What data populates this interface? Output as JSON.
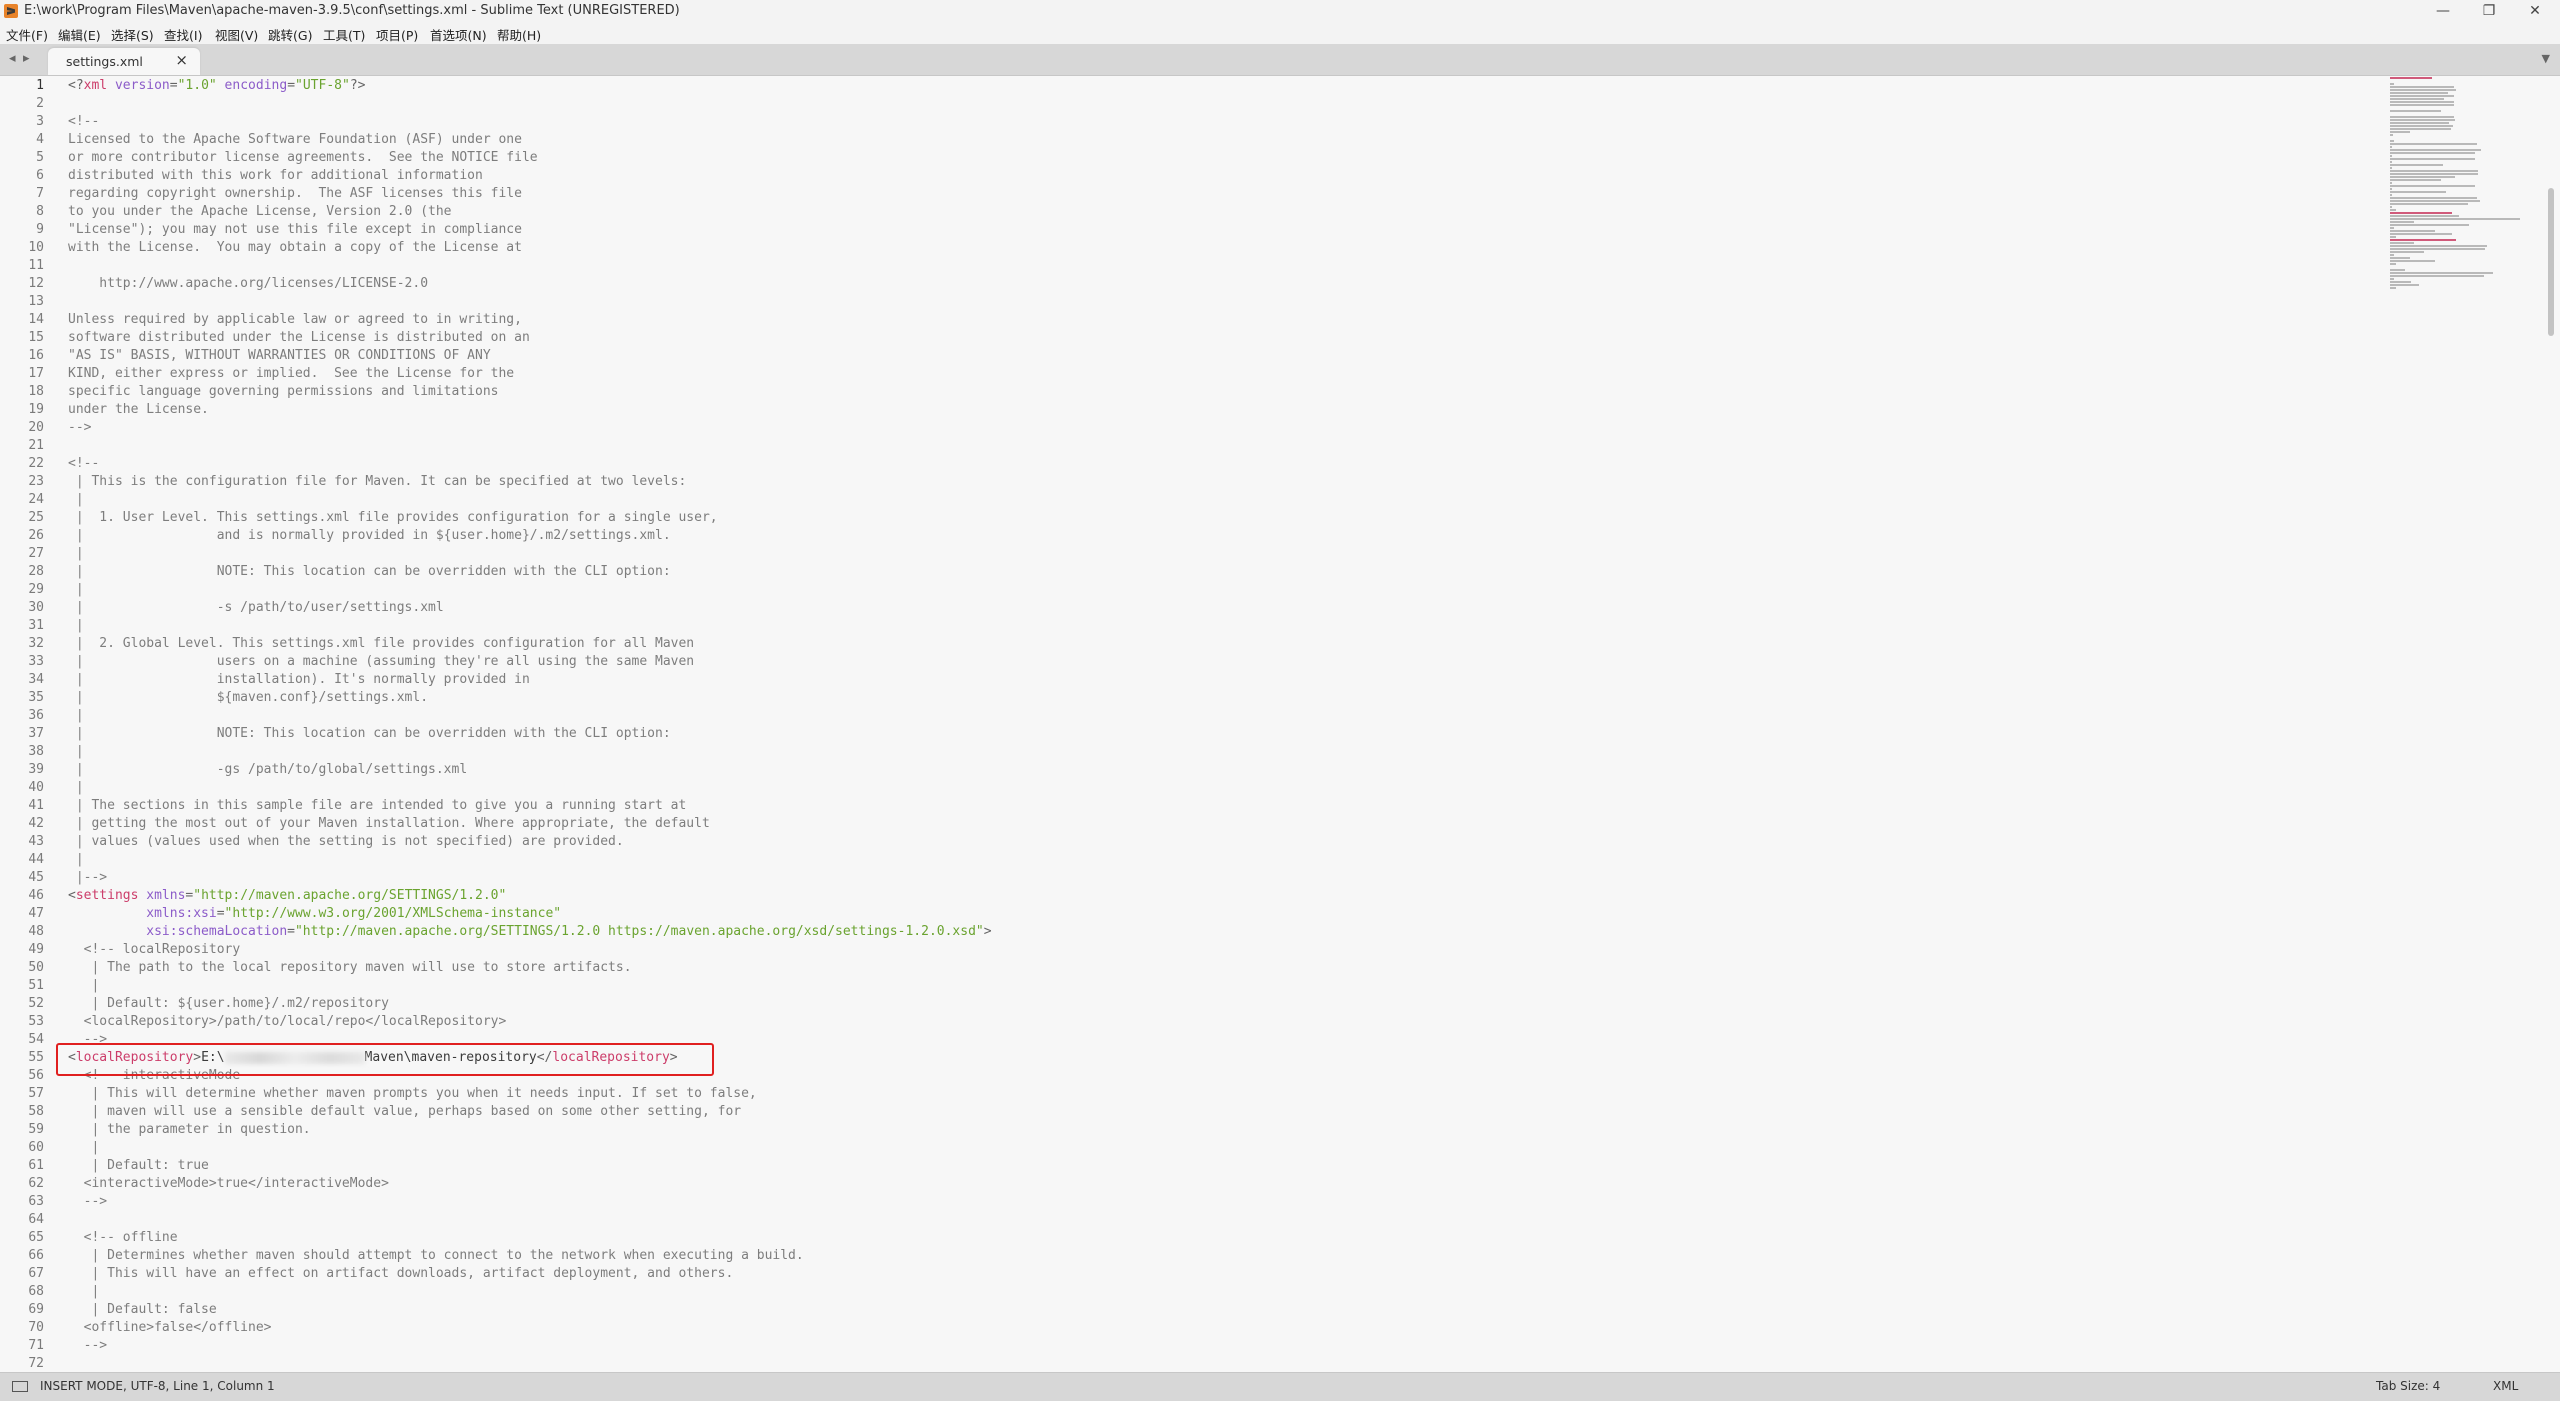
{
  "window": {
    "title": "E:\\work\\Program Files\\Maven\\apache-maven-3.9.5\\conf\\settings.xml - Sublime Text (UNREGISTERED)",
    "minimize": "—",
    "maximize": "❐",
    "close": "✕"
  },
  "menu": [
    "文件(F)",
    "编辑(E)",
    "选择(S)",
    "查找(I)",
    "视图(V)",
    "跳转(G)",
    "工具(T)",
    "项目(P)",
    "首选项(N)",
    "帮助(H)"
  ],
  "tabs": {
    "nav_left": "◂",
    "nav_right": "▸",
    "active_label": "settings.xml",
    "close_glyph": "×",
    "dropdown": "▼"
  },
  "editor": {
    "first_line_number": 1,
    "active_line": 1,
    "lines": [
      [
        [
          "<?",
          "punct"
        ],
        [
          "xml",
          "tag"
        ],
        [
          " version",
          "attr"
        ],
        [
          "=",
          "punct"
        ],
        [
          "\"1.0\"",
          "str"
        ],
        [
          " encoding",
          "attr"
        ],
        [
          "=",
          "punct"
        ],
        [
          "\"UTF-8\"",
          "str"
        ],
        [
          "?>",
          "punct"
        ]
      ],
      [],
      [
        [
          "<!--",
          "com"
        ]
      ],
      [
        [
          "Licensed to the Apache Software Foundation (ASF) under one",
          "com"
        ]
      ],
      [
        [
          "or more contributor license agreements.  See the NOTICE file",
          "com"
        ]
      ],
      [
        [
          "distributed with this work for additional information",
          "com"
        ]
      ],
      [
        [
          "regarding copyright ownership.  The ASF licenses this file",
          "com"
        ]
      ],
      [
        [
          "to you under the Apache License, Version 2.0 (the",
          "com"
        ]
      ],
      [
        [
          "\"License\"); you may not use this file except in compliance",
          "com"
        ]
      ],
      [
        [
          "with the License.  You may obtain a copy of the License at",
          "com"
        ]
      ],
      [],
      [
        [
          "    http://www.apache.org/licenses/LICENSE-2.0",
          "com"
        ]
      ],
      [],
      [
        [
          "Unless required by applicable law or agreed to in writing,",
          "com"
        ]
      ],
      [
        [
          "software distributed under the License is distributed on an",
          "com"
        ]
      ],
      [
        [
          "\"AS IS\" BASIS, WITHOUT WARRANTIES OR CONDITIONS OF ANY",
          "com"
        ]
      ],
      [
        [
          "KIND, either express or implied.  See the License for the",
          "com"
        ]
      ],
      [
        [
          "specific language governing permissions and limitations",
          "com"
        ]
      ],
      [
        [
          "under the License.",
          "com"
        ]
      ],
      [
        [
          "-->",
          "com"
        ]
      ],
      [],
      [
        [
          "<!--",
          "com"
        ]
      ],
      [
        [
          " | This is the configuration file for Maven. It can be specified at two levels:",
          "com"
        ]
      ],
      [
        [
          " |",
          "com"
        ]
      ],
      [
        [
          " |  1. User Level. This settings.xml file provides configuration for a single user,",
          "com"
        ]
      ],
      [
        [
          " |                 and is normally provided in ${user.home}/.m2/settings.xml.",
          "com"
        ]
      ],
      [
        [
          " |",
          "com"
        ]
      ],
      [
        [
          " |                 NOTE: This location can be overridden with the CLI option:",
          "com"
        ]
      ],
      [
        [
          " |",
          "com"
        ]
      ],
      [
        [
          " |                 -s /path/to/user/settings.xml",
          "com"
        ]
      ],
      [
        [
          " |",
          "com"
        ]
      ],
      [
        [
          " |  2. Global Level. This settings.xml file provides configuration for all Maven",
          "com"
        ]
      ],
      [
        [
          " |                 users on a machine (assuming they're all using the same Maven",
          "com"
        ]
      ],
      [
        [
          " |                 installation). It's normally provided in",
          "com"
        ]
      ],
      [
        [
          " |                 ${maven.conf}/settings.xml.",
          "com"
        ]
      ],
      [
        [
          " |",
          "com"
        ]
      ],
      [
        [
          " |                 NOTE: This location can be overridden with the CLI option:",
          "com"
        ]
      ],
      [
        [
          " |",
          "com"
        ]
      ],
      [
        [
          " |                 -gs /path/to/global/settings.xml",
          "com"
        ]
      ],
      [
        [
          " |",
          "com"
        ]
      ],
      [
        [
          " | The sections in this sample file are intended to give you a running start at",
          "com"
        ]
      ],
      [
        [
          " | getting the most out of your Maven installation. Where appropriate, the default",
          "com"
        ]
      ],
      [
        [
          " | values (values used when the setting is not specified) are provided.",
          "com"
        ]
      ],
      [
        [
          " |",
          "com"
        ]
      ],
      [
        [
          " |-->",
          "com"
        ]
      ],
      [
        [
          "<",
          "punct"
        ],
        [
          "settings",
          "tag"
        ],
        [
          " xmlns",
          "attr"
        ],
        [
          "=",
          "punct"
        ],
        [
          "\"http://maven.apache.org/SETTINGS/1.2.0\"",
          "str"
        ]
      ],
      [
        [
          "          xmlns:xsi",
          "attr"
        ],
        [
          "=",
          "punct"
        ],
        [
          "\"http://www.w3.org/2001/XMLSchema-instance\"",
          "str"
        ]
      ],
      [
        [
          "          xsi:schemaLocation",
          "attr"
        ],
        [
          "=",
          "punct"
        ],
        [
          "\"http://maven.apache.org/SETTINGS/1.2.0 https://maven.apache.org/xsd/settings-1.2.0.xsd\"",
          "str"
        ],
        [
          ">",
          "punct"
        ]
      ],
      [
        [
          "  <!-- localRepository",
          "com"
        ]
      ],
      [
        [
          "   | The path to the local repository maven will use to store artifacts.",
          "com"
        ]
      ],
      [
        [
          "   |",
          "com"
        ]
      ],
      [
        [
          "   | Default: ${user.home}/.m2/repository",
          "com"
        ]
      ],
      [
        [
          "  <localRepository>/path/to/local/repo</localRepository>",
          "com"
        ]
      ],
      [
        [
          "  -->",
          "com"
        ]
      ],
      [
        [
          "<",
          "punct"
        ],
        [
          "localRepository",
          "tag"
        ],
        [
          ">",
          "punct"
        ],
        [
          "E:\\",
          "txt"
        ],
        [
          "",
          "blur"
        ],
        [
          "Maven\\maven-repository",
          "txt"
        ],
        [
          "</",
          "punct"
        ],
        [
          "localRepository",
          "tag"
        ],
        [
          ">",
          "punct"
        ]
      ],
      [
        [
          "  <!-- interactiveMode",
          "com"
        ]
      ],
      [
        [
          "   | This will determine whether maven prompts you when it needs input. If set to false,",
          "com"
        ]
      ],
      [
        [
          "   | maven will use a sensible default value, perhaps based on some other setting, for",
          "com"
        ]
      ],
      [
        [
          "   | the parameter in question.",
          "com"
        ]
      ],
      [
        [
          "   |",
          "com"
        ]
      ],
      [
        [
          "   | Default: true",
          "com"
        ]
      ],
      [
        [
          "  <interactiveMode>true</interactiveMode>",
          "com"
        ]
      ],
      [
        [
          "  -->",
          "com"
        ]
      ],
      [],
      [
        [
          "  <!-- offline",
          "com"
        ]
      ],
      [
        [
          "   | Determines whether maven should attempt to connect to the network when executing a build.",
          "com"
        ]
      ],
      [
        [
          "   | This will have an effect on artifact downloads, artifact deployment, and others.",
          "com"
        ]
      ],
      [
        [
          "   |",
          "com"
        ]
      ],
      [
        [
          "   | Default: false",
          "com"
        ]
      ],
      [
        [
          "  <offline>false</offline>",
          "com"
        ]
      ],
      [
        [
          "  -->",
          "com"
        ]
      ],
      []
    ]
  },
  "status": {
    "left": "INSERT MODE, UTF-8, Line 1, Column 1",
    "tab_size": "Tab Size: 4",
    "syntax": "XML"
  }
}
